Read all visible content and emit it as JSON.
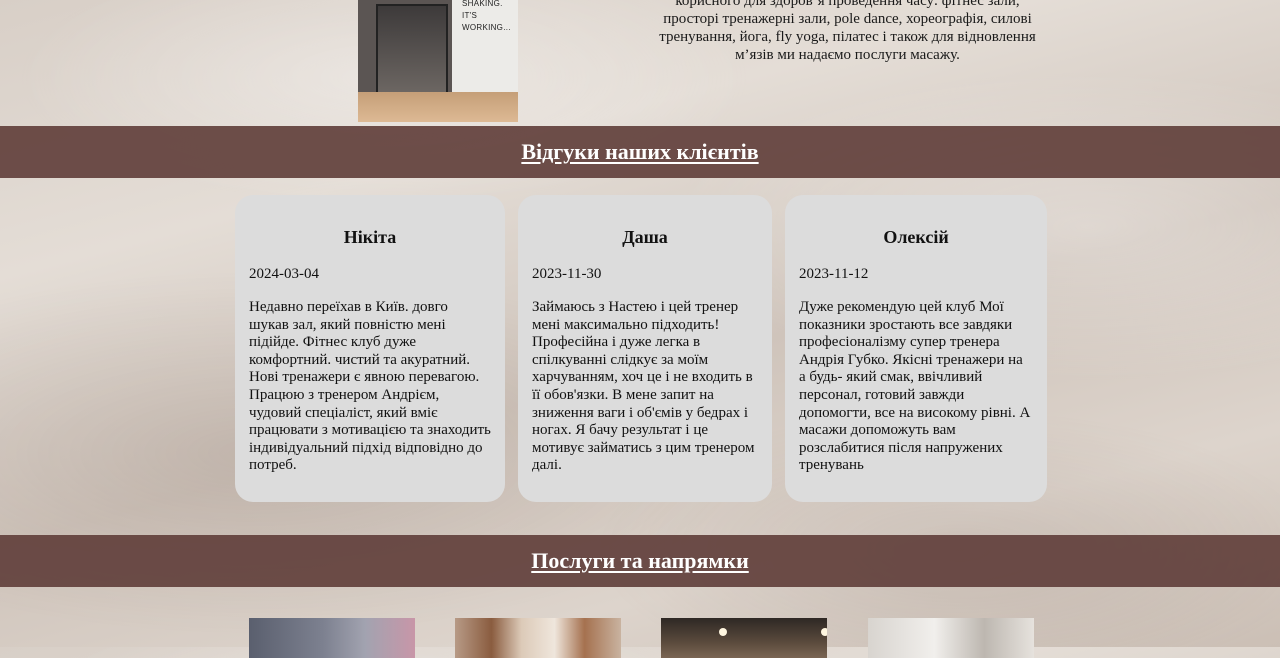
{
  "about": {
    "photo_wall_text": [
      "SHAKING.",
      "IT'S",
      "WORKING..."
    ],
    "lines": [
      "корисного для здоров`я проведення часу: фітнес зали,",
      "просторі тренажерні зали, pole dance, хореографія, силові",
      "тренування, йога, fly yoga, пілатес і також для відновлення",
      "м’язів ми надаємо послуги масажу."
    ]
  },
  "reviews": {
    "heading": "Відгуки наших клієнтів",
    "items": [
      {
        "name": "Нікіта",
        "date": "2024-03-04",
        "text": "Недавно переїхав в Київ. довго шукав зал, який повністю мені підійде. Фітнес клуб дуже комфортний. чистий та акуратний. Нові тренажери є явною перевагою. Працюю з тренером Андрієм, чудовий спеціаліст, який вміє працювати з мотивацією та знаходить індивідуальний підхід відповідно до потреб."
      },
      {
        "name": "Даша",
        "date": "2023-11-30",
        "text": "Займаюсь з Настею і цей тренер мені максимально підходить! Професійна і дуже легка в спілкуванні слідкує за моїм харчуванням, хоч це і не входить в її обов'язки. В мене запит на зниження ваги і об'ємів у бедрах і ногах. Я бачу результат і це мотивує займатись з цим тренером далі."
      },
      {
        "name": "Олексій",
        "date": "2023-11-12",
        "text": "Дуже рекомендую цей клуб Мої показники зростають все завдяки професіоналізму супер тренера Андрія Губко. Якісні тренажери на а будь- який смак, ввічливий персонал, готовий завжди допомогти, все на високому рівні. А масажи допоможуть вам розслабитися після напружених тренувань"
      }
    ]
  },
  "services": {
    "heading": "Послуги та напрямки"
  }
}
